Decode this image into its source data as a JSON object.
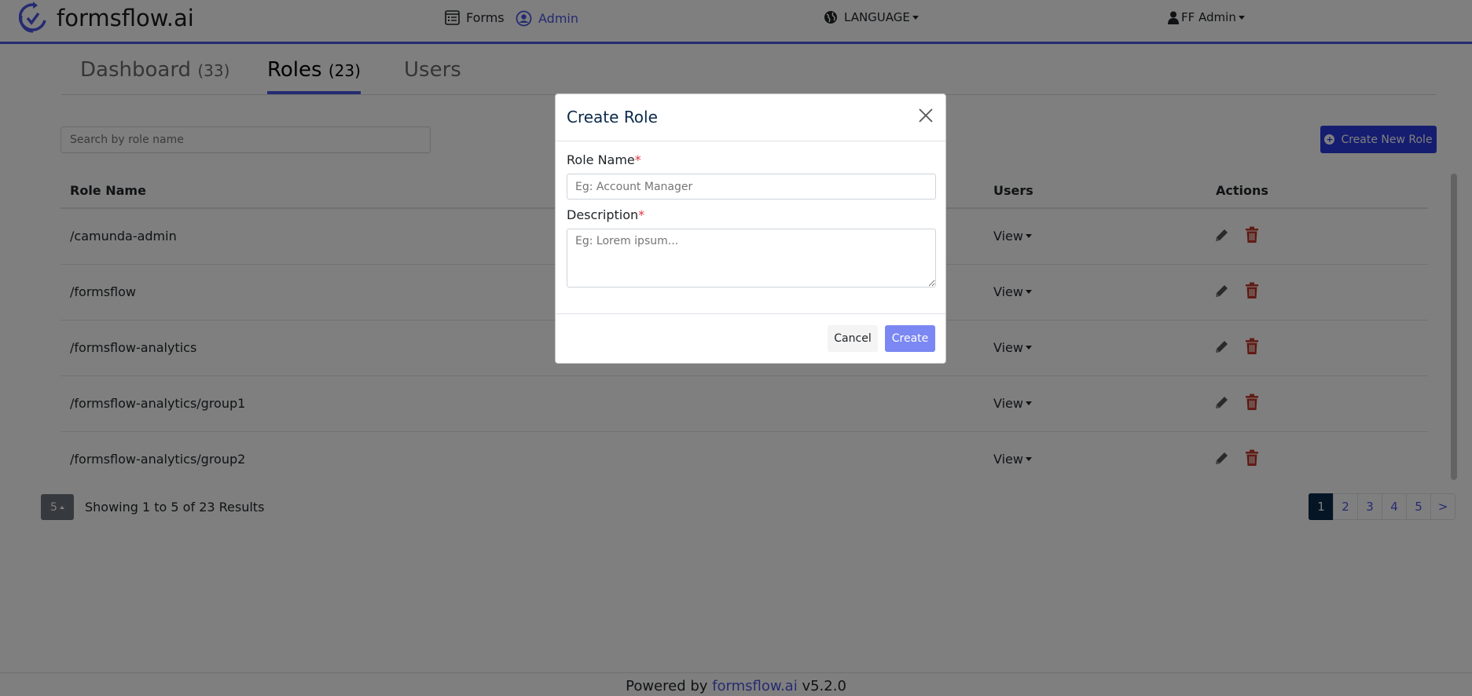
{
  "brand": {
    "name": "formsflow.ai"
  },
  "nav": {
    "forms_label": "Forms",
    "admin_label": "Admin",
    "language_label": "LANGUAGE",
    "user_label": "FF Admin"
  },
  "tabs": [
    {
      "label": "Dashboard",
      "count": "(33)"
    },
    {
      "label": "Roles",
      "count": "(23)",
      "active": true
    },
    {
      "label": "Users",
      "count": ""
    }
  ],
  "search": {
    "placeholder": "Search by role name"
  },
  "create_new_label": "Create New Role",
  "table": {
    "headers": {
      "role_name": "Role Name",
      "users": "Users",
      "actions": "Actions"
    },
    "rows": [
      {
        "role_name": "/camunda-admin",
        "users": "View"
      },
      {
        "role_name": "/formsflow",
        "users": "View"
      },
      {
        "role_name": "/formsflow-analytics",
        "users": "View"
      },
      {
        "role_name": "/formsflow-analytics/group1",
        "users": "View"
      },
      {
        "role_name": "/formsflow-analytics/group2",
        "users": "View"
      }
    ]
  },
  "pager": {
    "page_size": "5",
    "showing_text": "Showing 1 to 5 of 23 Results",
    "pages": [
      "1",
      "2",
      "3",
      "4",
      "5",
      ">"
    ],
    "active_page": "1"
  },
  "footer": {
    "prefix": "Powered by",
    "link": "formsflow.ai",
    "version": "v5.2.0"
  },
  "modal": {
    "title": "Create Role",
    "role_name_label": "Role Name",
    "role_name_placeholder": "Eg: Account Manager",
    "description_label": "Description",
    "description_placeholder": "Eg: Lorem ipsum...",
    "required_mark": "*",
    "cancel_label": "Cancel",
    "create_label": "Create"
  },
  "colors": {
    "accent": "#4a56e2",
    "primary_button": "#2a3ae0",
    "delete_icon": "#c0392b",
    "active_page": "#0b2a4a",
    "create_button_disabled": "#7b87f2"
  },
  "icons": {
    "brand": "formsflow-logo-icon",
    "forms": "forms-list-icon",
    "admin": "user-circle-icon",
    "language": "globe-icon",
    "user": "user-icon",
    "create_new": "plus-circle-icon",
    "edit": "pencil-icon",
    "delete": "trash-icon",
    "close": "close-icon"
  }
}
